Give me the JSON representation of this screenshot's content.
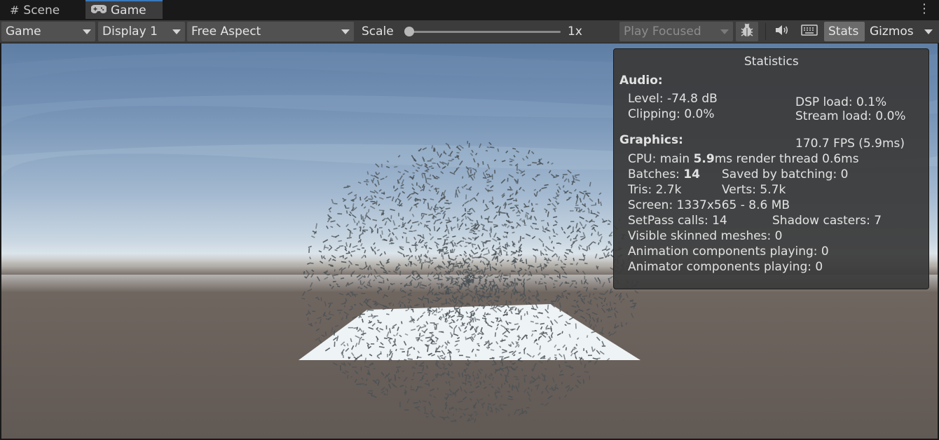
{
  "tabs": {
    "scene": "Scene",
    "game": "Game"
  },
  "toolbar": {
    "view_mode": "Game",
    "display": "Display 1",
    "aspect": "Free Aspect",
    "scale_label": "Scale",
    "scale_value": "1x",
    "play_mode": "Play Focused",
    "stats": "Stats",
    "gizmos": "Gizmos"
  },
  "stats": {
    "title": "Statistics",
    "audio_header": "Audio:",
    "level": "Level: -74.8 dB",
    "clipping": "Clipping: 0.0%",
    "dsp_load": "DSP load: 0.1%",
    "stream_load": "Stream load: 0.0%",
    "graphics_header": "Graphics:",
    "fps": "170.7 FPS (5.9ms)",
    "cpu_prefix": "CPU: main",
    "cpu_main": "5.9",
    "cpu_suffix": "ms  render thread 0.6ms",
    "batches_prefix": "Batches:",
    "batches_value": "14",
    "saved_by_batching": "Saved by batching: 0",
    "tris": "Tris: 2.7k",
    "verts": "Verts: 5.7k",
    "screen": "Screen: 1337x565 - 8.6 MB",
    "setpass": "SetPass calls: 14",
    "shadow_casters": "Shadow casters: 7",
    "visible_skinned": "Visible skinned meshes: 0",
    "animation_components": "Animation components playing: 0",
    "animator_components": "Animator components playing: 0"
  },
  "colors": {
    "accent": "#3a79bb",
    "toolbar": "#3c3c3c",
    "panel": "#3a3a3a",
    "particles": "#4b5256"
  }
}
